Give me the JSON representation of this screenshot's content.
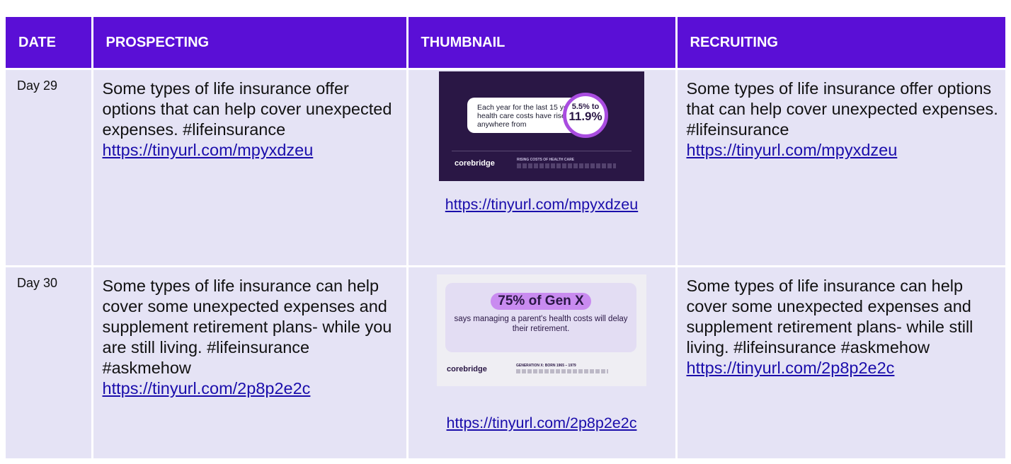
{
  "headers": {
    "date": "DATE",
    "prospecting": "PROSPECTING",
    "thumbnail": "THUMBNAIL",
    "recruiting": "RECRUITING"
  },
  "rows": [
    {
      "date": "Day 29",
      "prospecting": "Some types of life insurance offer options that can help cover unexpected expenses. #lifeinsurance",
      "prospecting_link": "https://tinyurl.com/mpyxdzeu",
      "thumbnail": {
        "text": "Each year for the last 15 years, health care costs have risen by anywhere from",
        "stat_top": "5.5% to",
        "stat_main": "11.9%",
        "brand": "corebridge",
        "brand_sub": "financial",
        "caption": "RISING COSTS OF HEALTH CARE"
      },
      "thumbnail_link": "https://tinyurl.com/mpyxdzeu",
      "recruiting": "Some types of life insurance offer options that can help cover unexpected expenses. #lifeinsurance",
      "recruiting_link": "https://tinyurl.com/mpyxdzeu"
    },
    {
      "date": "Day 30",
      "prospecting": "Some types of life insurance can help cover some unexpected expenses and supplement retirement plans- while you are still living. #lifeinsurance #askmehow",
      "prospecting_link": "https://tinyurl.com/2p8p2e2c",
      "thumbnail": {
        "headline": "75% of Gen X",
        "text": "says managing a parent's health costs will delay their retirement.",
        "brand": "corebridge",
        "brand_sub": "financial",
        "caption": "GENERATION X: BORN 1965 – 1979"
      },
      "thumbnail_link": "https://tinyurl.com/2p8p2e2c",
      "recruiting": "Some types of life insurance can help cover some unexpected expenses and supplement retirement plans- while still living. #lifeinsurance #askmehow",
      "recruiting_link": "https://tinyurl.com/2p8p2e2c"
    }
  ],
  "colors": {
    "header_bg": "#5a0fd6",
    "cell_bg": "#e5e3f5",
    "link": "#1a0dab"
  }
}
